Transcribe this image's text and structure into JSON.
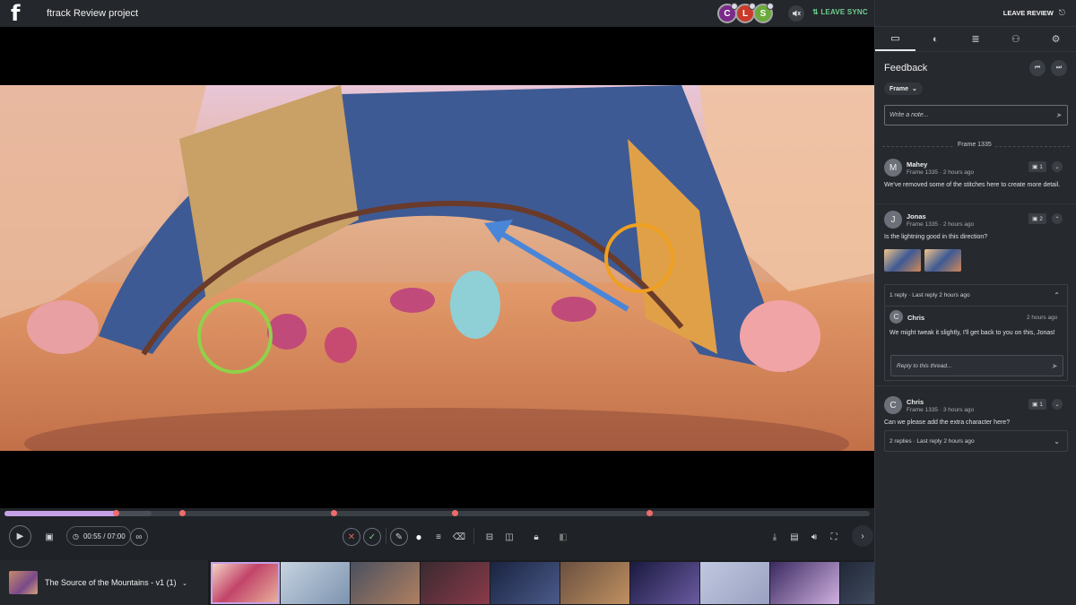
{
  "app": {
    "logo": "f",
    "project_title": "ftrack Review project"
  },
  "header": {
    "participants": [
      {
        "initial": "C",
        "color": "#7b2a8a"
      },
      {
        "initial": "L",
        "color": "#c93a2a"
      },
      {
        "initial": "S",
        "color": "#6aaa3a"
      }
    ],
    "mute_icon": "muted-speaker-icon",
    "leave_sync_label": "LEAVE SYNC",
    "leave_sync_icon": "sync-off-icon",
    "leave_review_label": "LEAVE REVIEW"
  },
  "sidebar": {
    "tabs": [
      {
        "icon": "chat-bubble-icon",
        "active": true
      },
      {
        "icon": "color-wheel-icon",
        "active": false
      },
      {
        "icon": "list-icon",
        "active": false
      },
      {
        "icon": "add-user-icon",
        "active": false
      },
      {
        "icon": "gear-icon",
        "active": false
      }
    ],
    "feedback_title": "Feedback",
    "frame_filter": "Frame",
    "note_placeholder": "Write a note...",
    "frame_divider": "Frame 1335",
    "comments": [
      {
        "initial": "M",
        "author": "Mahey",
        "meta": "Frame 1335 · 2 hours ago",
        "text": "We've removed some of the stitches here to create more detail.",
        "frame_count": "1"
      },
      {
        "initial": "J",
        "author": "Jonas",
        "meta": "Frame 1335 · 2 hours ago",
        "text": "Is the lightning good in this direction?",
        "frame_count": "2",
        "thread": {
          "summary": "1 reply · Last reply 2 hours ago",
          "reply": {
            "initial": "C",
            "author": "Chris",
            "time": "2 hours ago",
            "text": "We might tweak it slightly, I'll get back to you on this, Jonas!"
          },
          "reply_placeholder": "Reply to this thread..."
        }
      },
      {
        "initial": "C",
        "author": "Chris",
        "meta": "Frame 1335 · 3 hours ago",
        "text": "Can we please add the extra character here?",
        "frame_count": "1",
        "replies_summary": "2 replies · Last reply 2 hours ago"
      }
    ]
  },
  "player": {
    "time": "00:55 / 07:00",
    "progress_fraction": 0.13,
    "buffered_fraction": 0.17,
    "marker_fractions": [
      0.128,
      0.205,
      0.38,
      0.52,
      0.745
    ],
    "annotation_colors": {
      "circle_green": "#8fd24a",
      "circle_orange": "#f0a020",
      "arrow_blue": "#4a86d8"
    }
  },
  "filmstrip": {
    "version_title": "The Source of the Mountains",
    "version_suffix": " - v1 (1)"
  }
}
